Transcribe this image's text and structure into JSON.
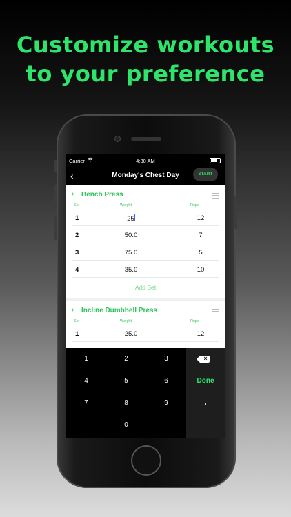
{
  "headline": {
    "line1": "Customize workouts",
    "line2": "to your preference"
  },
  "status_bar": {
    "carrier": "Carrier",
    "time": "4:30 AM"
  },
  "nav": {
    "back_icon": "chevron-left-icon",
    "title": "Monday's Chest Day",
    "start_label": "START"
  },
  "columns": {
    "set": "Set",
    "weight": "Weight",
    "reps": "Reps"
  },
  "exercises": [
    {
      "name": "Bench Press",
      "sets": [
        {
          "set": "1",
          "weight": "25",
          "reps": "12"
        },
        {
          "set": "2",
          "weight": "50.0",
          "reps": "7"
        },
        {
          "set": "3",
          "weight": "75.0",
          "reps": "5"
        },
        {
          "set": "4",
          "weight": "35.0",
          "reps": "10"
        }
      ],
      "add_set_label": "Add Set"
    },
    {
      "name": "Incline Dumbbell Press",
      "sets": [
        {
          "set": "1",
          "weight": "25.0",
          "reps": "12"
        }
      ]
    }
  ],
  "keypad": {
    "keys": [
      "1",
      "2",
      "3",
      "4",
      "5",
      "6",
      "7",
      "8",
      "9",
      "0"
    ],
    "done_label": "Done",
    "decimal_label": ".",
    "backspace_icon": "backspace-icon"
  },
  "colors": {
    "accent": "#2ee46a",
    "card_bg": "#ffffff",
    "keyboard_bg": "#000000"
  }
}
